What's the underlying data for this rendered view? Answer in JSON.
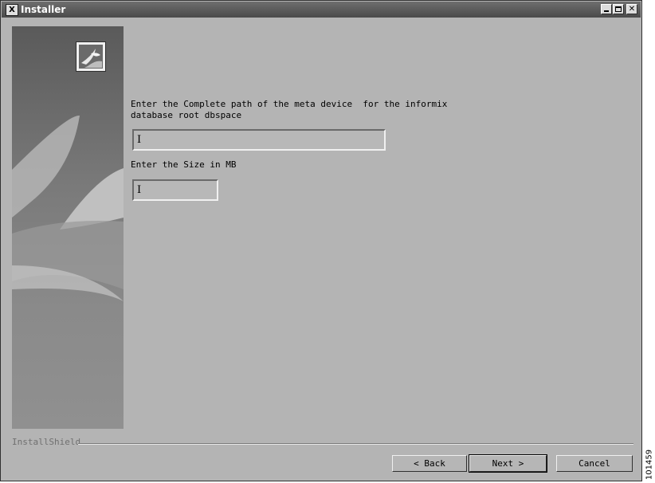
{
  "window": {
    "title": "Installer",
    "app_icon_glyph": "X",
    "controls": {
      "minimize": "_",
      "maximize": "□",
      "close": "✕"
    }
  },
  "form": {
    "path_prompt_line1": "Enter the Complete path of the meta device  for the informix",
    "path_prompt_line2": "database root dbspace",
    "path_value": "",
    "size_prompt": "Enter the Size in MB",
    "size_value": ""
  },
  "footer": {
    "brand": "InstallShield",
    "back_label": "< Back",
    "next_label": "Next >",
    "cancel_label": "Cancel"
  },
  "figure_id": "101459",
  "icons": {
    "app": "x-window-icon",
    "logo": "installshield-logo-icon"
  }
}
